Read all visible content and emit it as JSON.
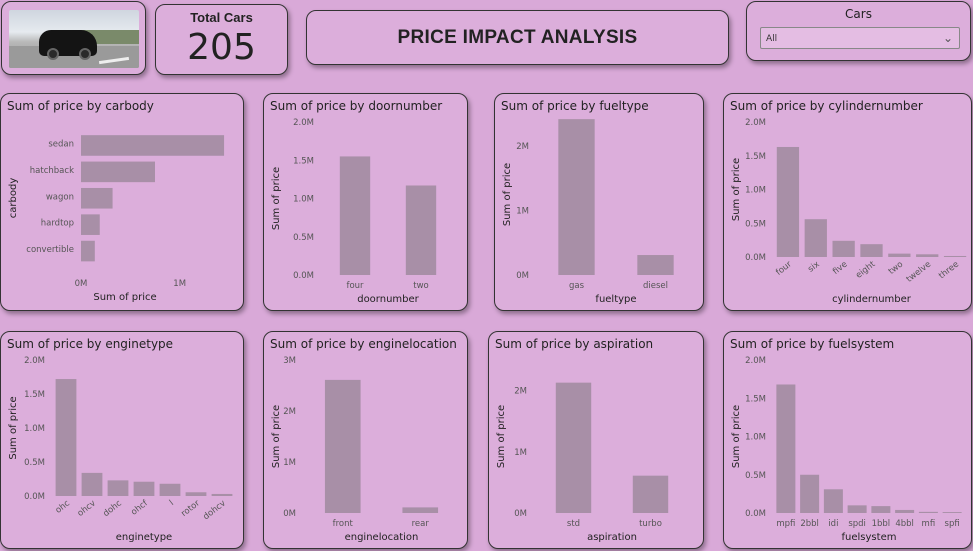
{
  "header": {
    "image_alt": "black sports car on road",
    "kpi": {
      "label": "Total Cars",
      "value": "205"
    },
    "title": "PRICE IMPACT ANALYSIS",
    "slicer": {
      "label": "Cars",
      "value": "All"
    }
  },
  "colors": {
    "background": "#d9a9d8",
    "bar": "#a88fa7",
    "card": "#dcaedb"
  },
  "chart_data": [
    {
      "id": "carbody",
      "type": "bar",
      "orientation": "horizontal",
      "title": "Sum of price by carbody",
      "xlabel": "Sum of price",
      "ylabel": "carbody",
      "categories": [
        "sedan",
        "hatchback",
        "wagon",
        "hardtop",
        "convertible"
      ],
      "values": [
        1450000,
        750000,
        320000,
        190000,
        140000
      ],
      "ticks": [
        {
          "v": 0,
          "label": "0M"
        },
        {
          "v": 1000000,
          "label": "1M"
        }
      ],
      "ylim": [
        0,
        1500000
      ]
    },
    {
      "id": "doornumber",
      "type": "bar",
      "title": "Sum of price by doornumber",
      "xlabel": "doornumber",
      "ylabel": "Sum of price",
      "categories": [
        "four",
        "two"
      ],
      "values": [
        1550000,
        1170000
      ],
      "ticks": [
        {
          "v": 0,
          "label": "0.0M"
        },
        {
          "v": 500000,
          "label": "0.5M"
        },
        {
          "v": 1000000,
          "label": "1.0M"
        },
        {
          "v": 1500000,
          "label": "1.5M"
        },
        {
          "v": 2000000,
          "label": "2.0M"
        }
      ],
      "ylim": [
        0,
        2000000
      ],
      "rotate": false
    },
    {
      "id": "fueltype",
      "type": "bar",
      "title": "Sum of price by fueltype",
      "xlabel": "fueltype",
      "ylabel": "Sum of price",
      "categories": [
        "gas",
        "diesel"
      ],
      "values": [
        2420000,
        310000
      ],
      "ticks": [
        {
          "v": 0,
          "label": "0M"
        },
        {
          "v": 1000000,
          "label": "1M"
        },
        {
          "v": 2000000,
          "label": "2M"
        }
      ],
      "ylim": [
        0,
        2500000
      ],
      "rotate": false
    },
    {
      "id": "cylindernumber",
      "type": "bar",
      "title": "Sum of price by cylindernumber",
      "xlabel": "cylindernumber",
      "ylabel": "Sum of price",
      "categories": [
        "four",
        "six",
        "five",
        "eight",
        "two",
        "twelve",
        "three"
      ],
      "values": [
        1630000,
        560000,
        240000,
        190000,
        50000,
        40000,
        15000
      ],
      "ticks": [
        {
          "v": 0,
          "label": "0.0M"
        },
        {
          "v": 500000,
          "label": "0.5M"
        },
        {
          "v": 1000000,
          "label": "1.0M"
        },
        {
          "v": 1500000,
          "label": "1.5M"
        },
        {
          "v": 2000000,
          "label": "2.0M"
        }
      ],
      "ylim": [
        0,
        2000000
      ],
      "rotate": true
    },
    {
      "id": "enginetype",
      "type": "bar",
      "title": "Sum of price by enginetype",
      "xlabel": "enginetype",
      "ylabel": "Sum of price",
      "categories": [
        "ohc",
        "ohcv",
        "dohc",
        "ohcf",
        "l",
        "rotor",
        "dohcv"
      ],
      "values": [
        1720000,
        340000,
        230000,
        210000,
        180000,
        55000,
        30000
      ],
      "ticks": [
        {
          "v": 0,
          "label": "0.0M"
        },
        {
          "v": 500000,
          "label": "0.5M"
        },
        {
          "v": 1000000,
          "label": "1.0M"
        },
        {
          "v": 1500000,
          "label": "1.5M"
        },
        {
          "v": 2000000,
          "label": "2.0M"
        }
      ],
      "ylim": [
        0,
        2000000
      ],
      "rotate": true
    },
    {
      "id": "enginelocation",
      "type": "bar",
      "title": "Sum of price by enginelocation",
      "xlabel": "enginelocation",
      "ylabel": "Sum of price",
      "categories": [
        "front",
        "rear"
      ],
      "values": [
        2610000,
        110000
      ],
      "ticks": [
        {
          "v": 0,
          "label": "0M"
        },
        {
          "v": 1000000,
          "label": "1M"
        },
        {
          "v": 2000000,
          "label": "2M"
        },
        {
          "v": 3000000,
          "label": "3M"
        }
      ],
      "ylim": [
        0,
        3000000
      ],
      "rotate": false
    },
    {
      "id": "aspiration",
      "type": "bar",
      "title": "Sum of price by aspiration",
      "xlabel": "aspiration",
      "ylabel": "Sum of price",
      "categories": [
        "std",
        "turbo"
      ],
      "values": [
        2130000,
        610000
      ],
      "ticks": [
        {
          "v": 0,
          "label": "0M"
        },
        {
          "v": 1000000,
          "label": "1M"
        },
        {
          "v": 2000000,
          "label": "2M"
        }
      ],
      "ylim": [
        0,
        2500000
      ],
      "rotate": false
    },
    {
      "id": "fuelsystem",
      "type": "bar",
      "title": "Sum of price by fuelsystem",
      "xlabel": "fuelsystem",
      "ylabel": "Sum of price",
      "categories": [
        "mpfi",
        "2bbl",
        "idi",
        "spdi",
        "1bbl",
        "4bbl",
        "mfi",
        "spfi"
      ],
      "values": [
        1680000,
        500000,
        310000,
        100000,
        90000,
        40000,
        15000,
        12000
      ],
      "ticks": [
        {
          "v": 0,
          "label": "0.0M"
        },
        {
          "v": 500000,
          "label": "0.5M"
        },
        {
          "v": 1000000,
          "label": "1.0M"
        },
        {
          "v": 1500000,
          "label": "1.5M"
        },
        {
          "v": 2000000,
          "label": "2.0M"
        }
      ],
      "ylim": [
        0,
        2000000
      ],
      "rotate": false
    }
  ]
}
